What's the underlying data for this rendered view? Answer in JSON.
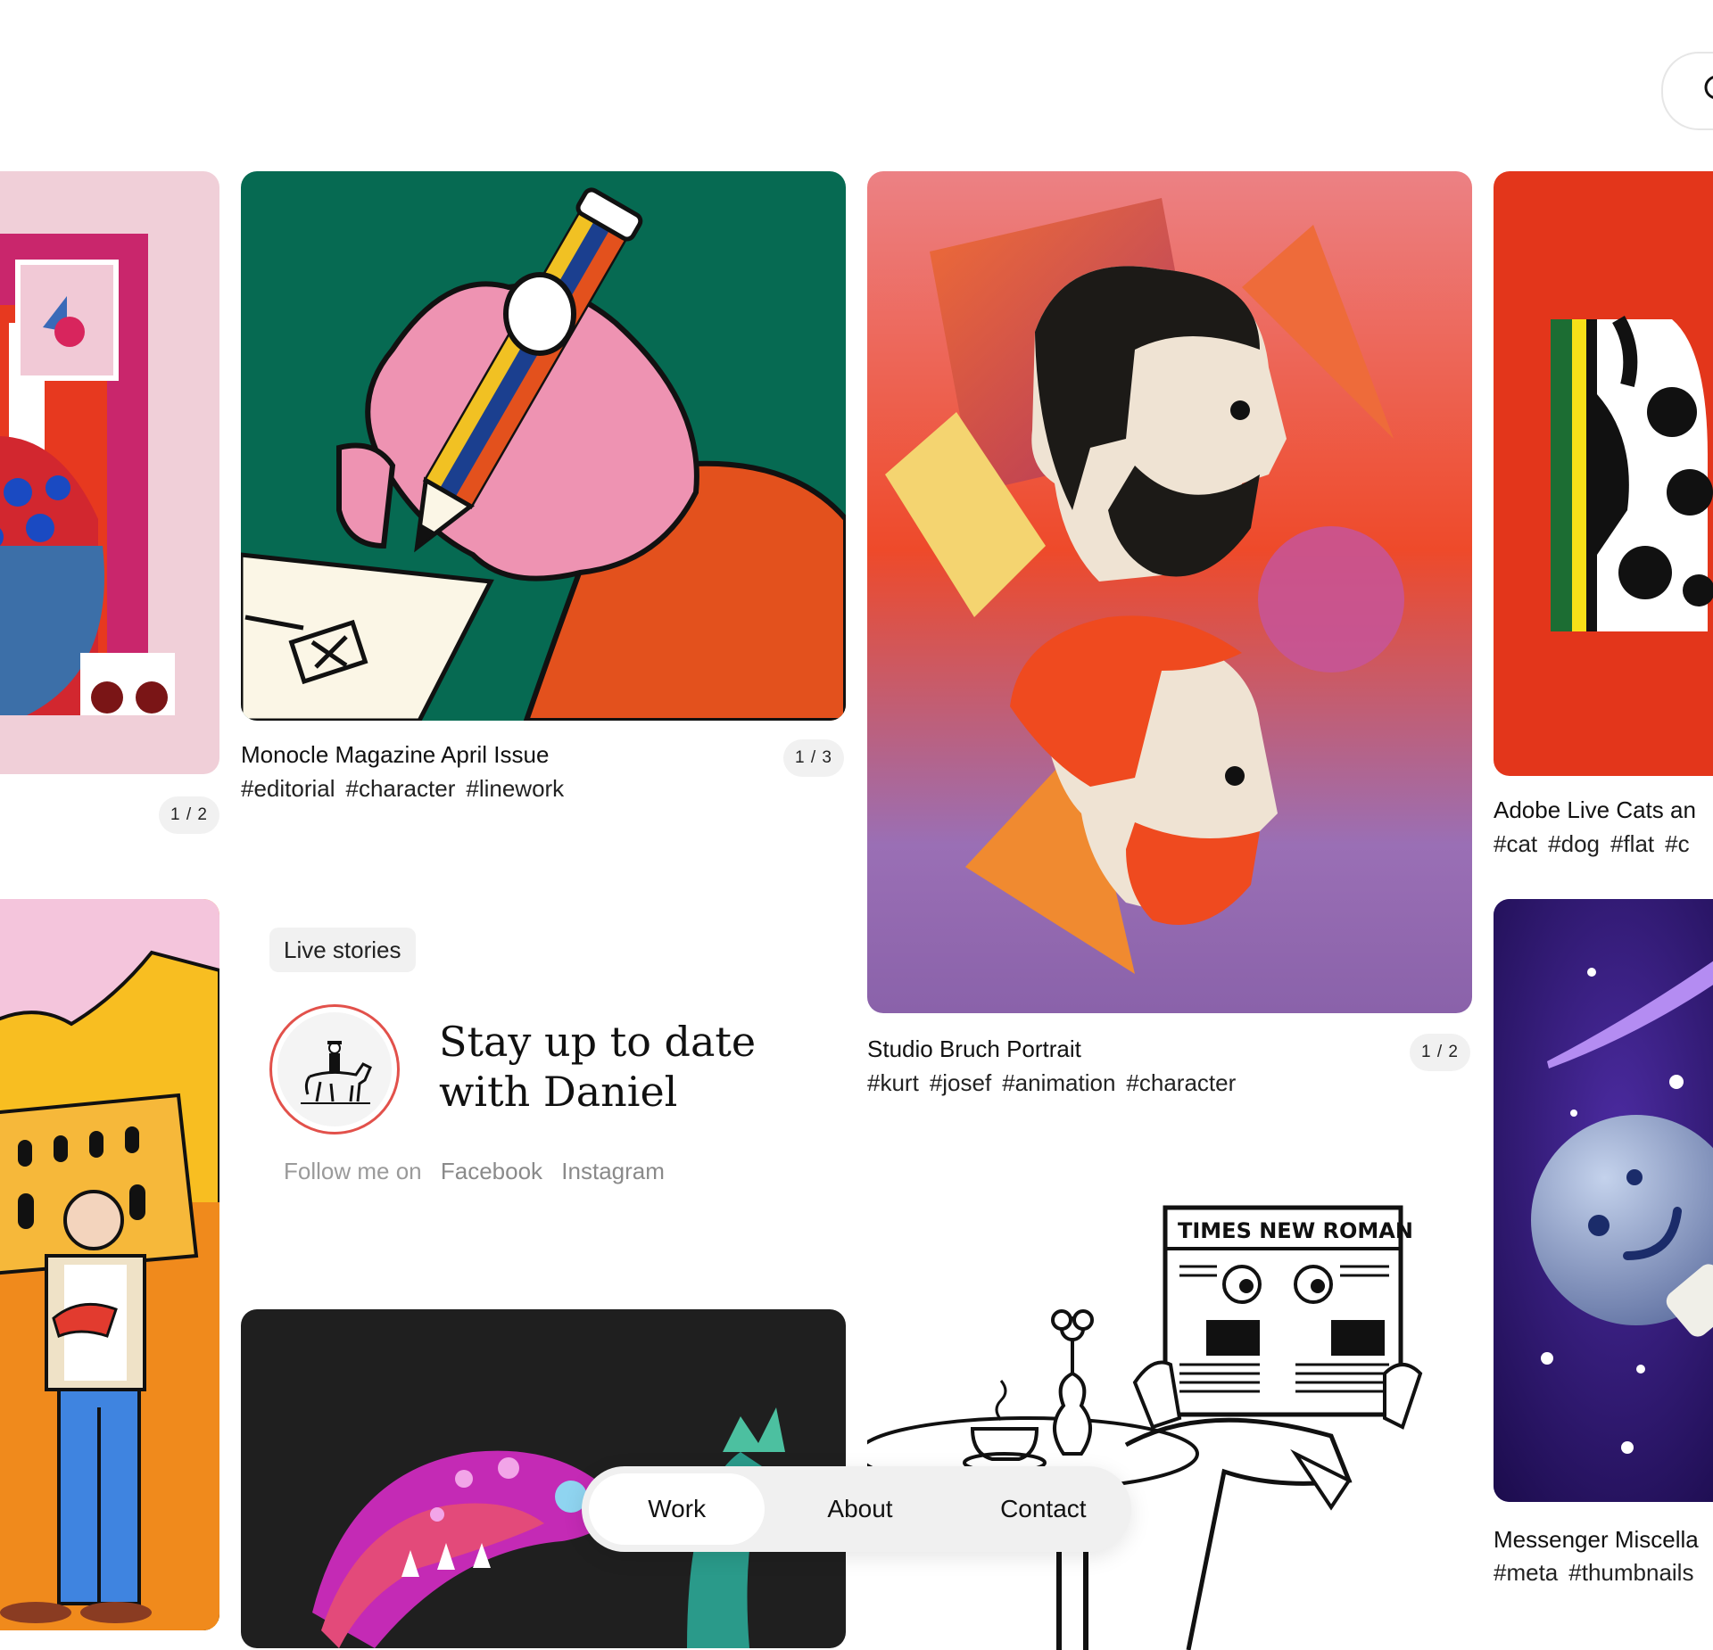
{
  "projects": [
    {
      "counter": "1 / 2"
    },
    {
      "title": "Monocle Magazine April Issue",
      "tags": [
        "#editorial",
        "#character",
        "#linework"
      ],
      "counter": "1 / 3"
    },
    {
      "title": "Studio Bruch Portrait",
      "tags": [
        "#kurt",
        "#josef",
        "#animation",
        "#character"
      ],
      "counter": "1 / 2"
    },
    {
      "title": "Adobe Live Cats an",
      "tags": [
        "#cat",
        "#dog",
        "#flat",
        "#c"
      ]
    },
    {
      "title": "Messenger Miscella",
      "tags": [
        "#meta",
        "#thumbnails"
      ]
    },
    {
      "illustration_text": "TIMES NEW ROMAN"
    }
  ],
  "live_stories": {
    "badge": "Live stories",
    "heading_line1": "Stay up to date",
    "heading_line2": "with Daniel",
    "follow_prefix": "Follow me on",
    "links": [
      "Facebook",
      "Instagram"
    ]
  },
  "nav": {
    "items": [
      "Work",
      "About",
      "Contact"
    ],
    "active": "Work"
  },
  "colors": {
    "accent_ring": "#e2514b",
    "counter_bg": "#f1f1f1",
    "nav_bg": "#f0f0f0"
  }
}
